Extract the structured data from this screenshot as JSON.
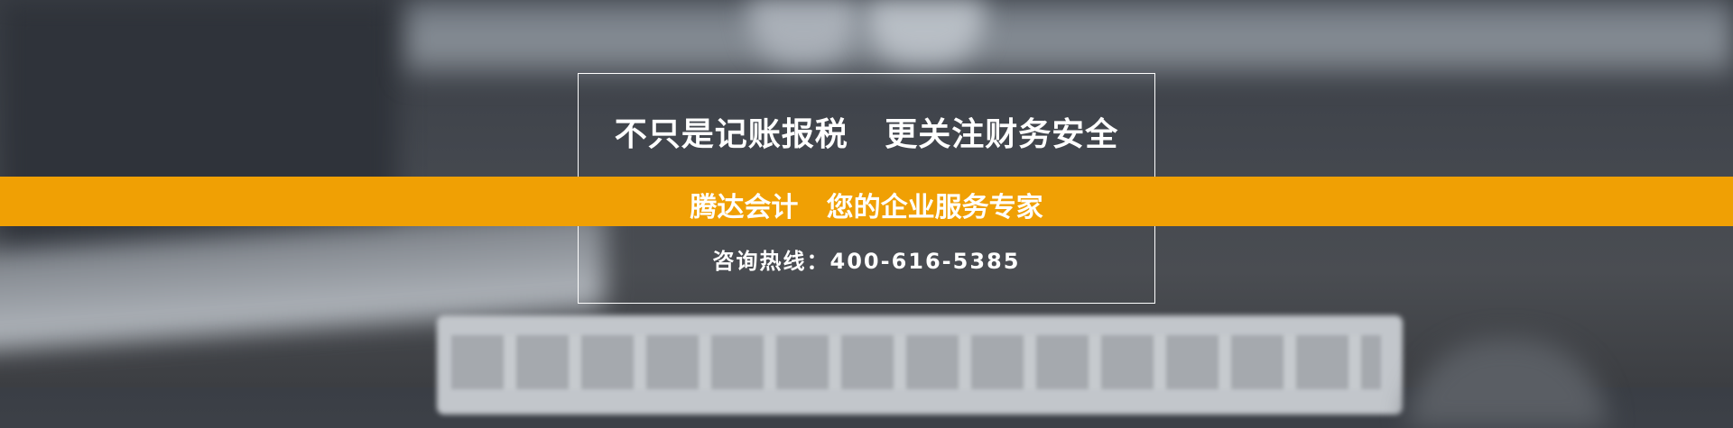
{
  "banner": {
    "headline": "不只是记账报税   更关注财务安全",
    "tagline": "腾达会计   您的企业服务专家",
    "hotline": "咨询热线：400-616-5385",
    "accent_color": "#f0a004"
  }
}
